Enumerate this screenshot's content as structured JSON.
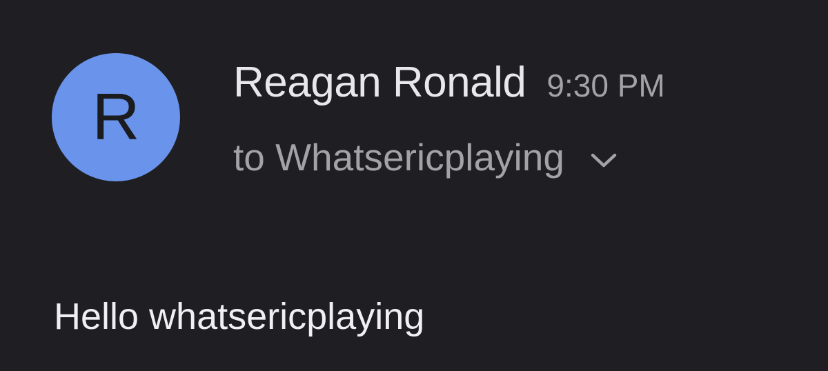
{
  "message": {
    "avatar_letter": "R",
    "sender_name": "Reagan Ronald",
    "time": "9:30 PM",
    "recipient_text": "to Whatsericplaying",
    "body": "Hello whatsericplaying"
  },
  "icons": {
    "details_toggle": "chevron-down-icon"
  },
  "colors": {
    "background": "#1f1f23",
    "avatar": "#6a94eb",
    "primary_text": "#e8e8ea",
    "secondary_text": "#a3a3a7"
  }
}
